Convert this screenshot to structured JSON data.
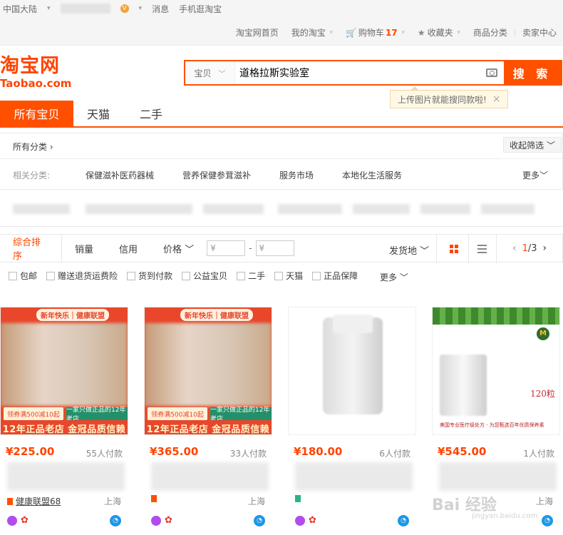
{
  "topbar": {
    "region": "中国大陆",
    "messages": "消息",
    "mobile": "手机逛淘宝",
    "nav": [
      "淘宝网首页",
      "我的淘宝"
    ],
    "cart_label": "购物车",
    "cart_count": "17",
    "favorites": "收藏夹",
    "categories": "商品分类",
    "seller": "卖家中心"
  },
  "logo": {
    "cn": "淘宝网",
    "en": "Taobao.com"
  },
  "search": {
    "scope": "宝贝",
    "query": "道格拉斯实验室",
    "button": "搜 索",
    "tooltip": "上传图片就能搜同款啦!"
  },
  "tabs": [
    "所有宝贝",
    "天猫",
    "二手"
  ],
  "filters": {
    "all_categories": "所有分类",
    "collapse": "收起筛选",
    "related_label": "相关分类:",
    "related": [
      "保健滋补医药器械",
      "营养保健参茸滋补",
      "服务市场",
      "本地化生活服务"
    ],
    "more": "更多"
  },
  "sort": {
    "items": [
      "综合排序",
      "销量",
      "信用",
      "价格"
    ],
    "price_from": "¥",
    "price_to": "¥",
    "ship_from": "发货地",
    "page_current": "1",
    "page_total": "/3"
  },
  "checks": [
    "包邮",
    "赠送退货运费险",
    "货到付款",
    "公益宝贝",
    "二手",
    "天猫",
    "正品保障"
  ],
  "checks_more": "更多",
  "products": [
    {
      "price": "¥225.00",
      "sold": "55人付款",
      "shop": "健康联盟68",
      "location": "上海",
      "tag": "新年快乐｜健康联盟",
      "coupon": "领券满500减10起",
      "green": "一家只做正品的12年老店",
      "band": "12年正品老店 金冠品质信赖"
    },
    {
      "price": "¥365.00",
      "sold": "33人付款",
      "shop": "",
      "location": "上海",
      "tag": "新年快乐｜健康联盟",
      "coupon": "领券满500减10起",
      "green": "一家只做正品的12年老店",
      "band": "12年正品老店 金冠品质信赖"
    },
    {
      "price": "¥180.00",
      "sold": "6人付款",
      "shop": "",
      "location": ""
    },
    {
      "price": "¥545.00",
      "sold": "1人付款",
      "shop": "",
      "location": "上海",
      "count": "120粒",
      "caption": "美国专业医疗级处方 · 为您甄选百年优质保养素"
    }
  ],
  "watermark": {
    "main": "Bai 经验",
    "sub": "jingyan.baidu.com"
  },
  "colors": {
    "brand": "#ff5000",
    "price": "#ff4400"
  }
}
